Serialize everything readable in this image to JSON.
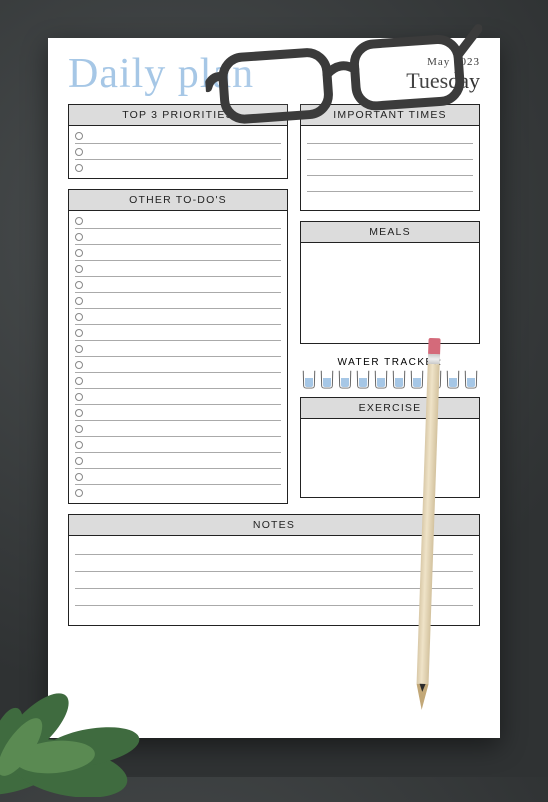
{
  "header": {
    "title": "Daily plan",
    "date_top": "May 2023",
    "date_day": "Tuesday"
  },
  "sections": {
    "priorities": {
      "label": "TOP 3 PRIORITIES",
      "rows": 3
    },
    "todos": {
      "label": "OTHER TO-DO'S",
      "rows": 18
    },
    "important": {
      "label": "IMPORTANT TIMES",
      "rows": 5
    },
    "meals": {
      "label": "MEALS"
    },
    "water": {
      "label": "WATER TRACKER",
      "glasses": 10
    },
    "exercise": {
      "label": "EXERCISE"
    },
    "notes": {
      "label": "NOTES",
      "rows": 5
    }
  },
  "colors": {
    "accent": "#a6c7e6",
    "header_bg": "#dcdcdc",
    "border": "#222222"
  }
}
